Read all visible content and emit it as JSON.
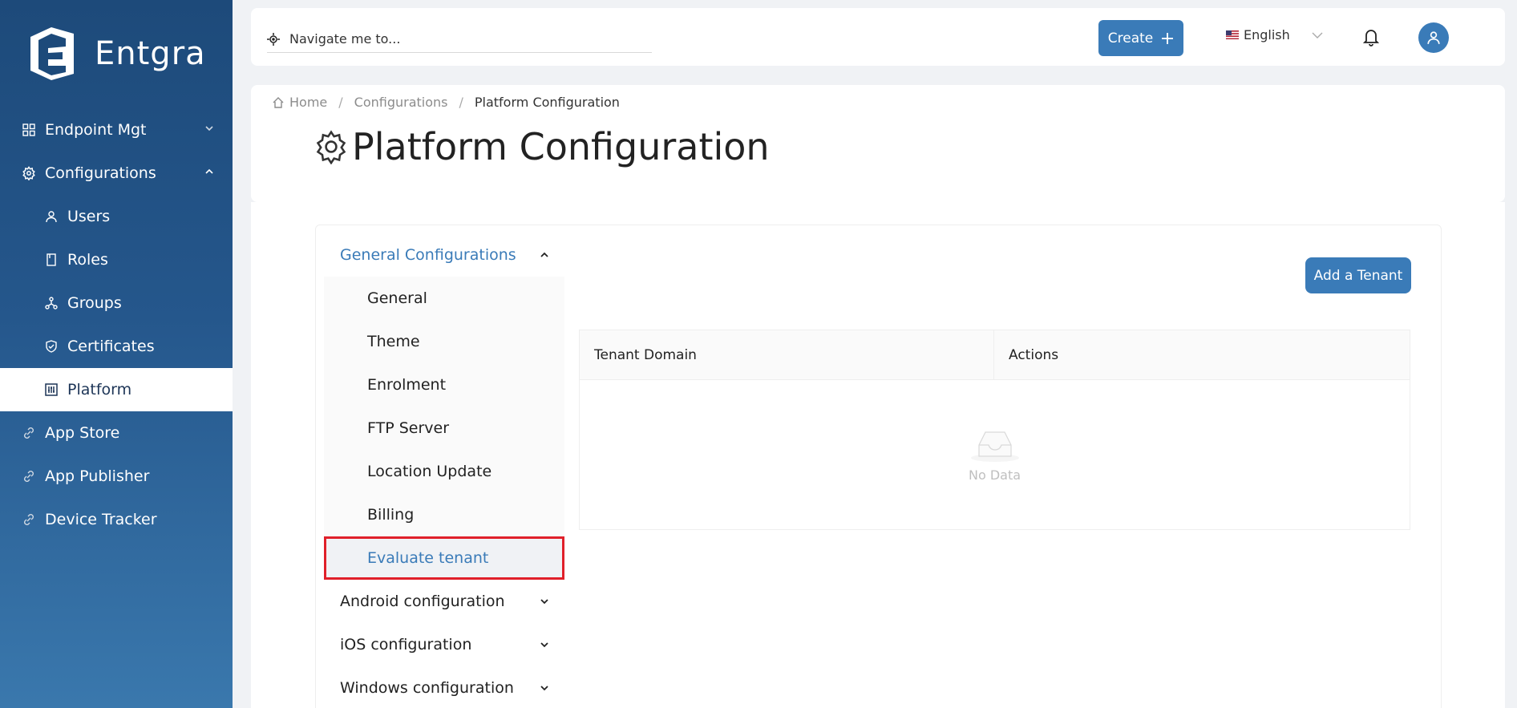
{
  "brand": {
    "name": "Entgra"
  },
  "sidebar": {
    "items": [
      {
        "label": "Endpoint Mgt",
        "icon": "grid-icon"
      },
      {
        "label": "Configurations",
        "icon": "gear-icon"
      },
      {
        "label": "Users",
        "icon": "user-icon"
      },
      {
        "label": "Roles",
        "icon": "book-icon"
      },
      {
        "label": "Groups",
        "icon": "nodes-icon"
      },
      {
        "label": "Certificates",
        "icon": "shield-icon"
      },
      {
        "label": "Platform",
        "icon": "sliders-icon"
      },
      {
        "label": "App Store",
        "icon": "link-icon"
      },
      {
        "label": "App Publisher",
        "icon": "link-icon"
      },
      {
        "label": "Device Tracker",
        "icon": "link-icon"
      }
    ]
  },
  "topbar": {
    "search_placeholder": "Navigate me to...",
    "create_label": "Create",
    "language": "English"
  },
  "breadcrumb": {
    "home": "Home",
    "configurations": "Configurations",
    "current": "Platform Configuration"
  },
  "page": {
    "title": "Platform Configuration"
  },
  "config_menu": {
    "general_group": "General Configurations",
    "general_items": [
      "General",
      "Theme",
      "Enrolment",
      "FTP Server",
      "Location Update",
      "Billing",
      "Evaluate tenant"
    ],
    "groups": [
      "Android configuration",
      "iOS configuration",
      "Windows configuration"
    ]
  },
  "tenants": {
    "add_label": "Add a Tenant",
    "columns": [
      "Tenant Domain",
      "Actions"
    ],
    "empty_text": "No Data"
  },
  "colors": {
    "accent": "#3a7bb8",
    "sidebar": "#1d4a7a",
    "highlight": "#e0202a"
  }
}
